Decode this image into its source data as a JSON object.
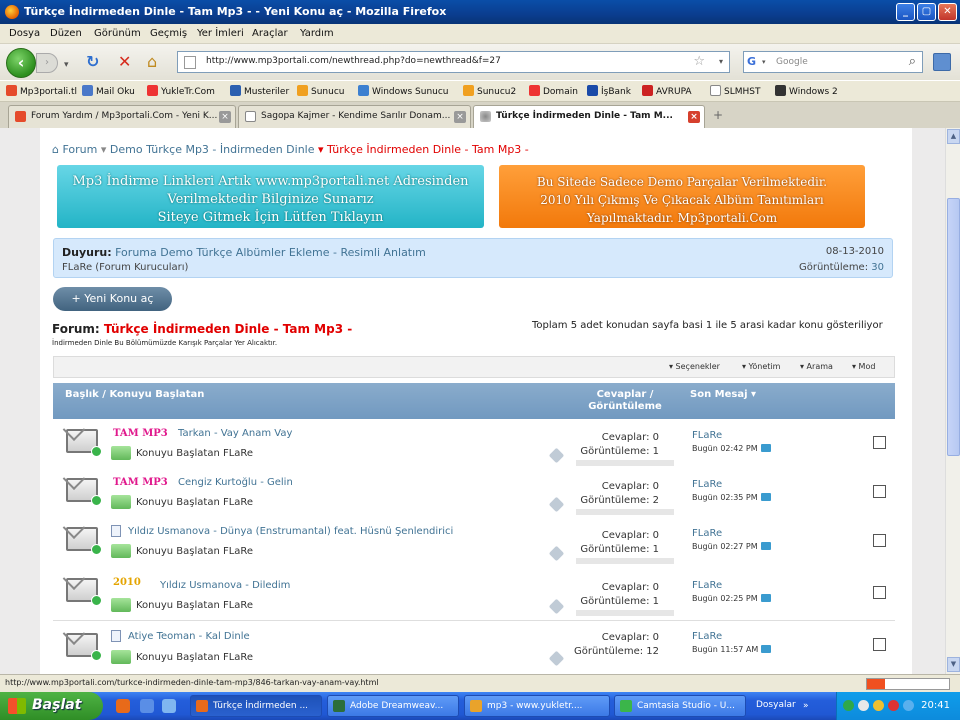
{
  "window": {
    "title": "Türkçe İndirmeden Dinle - Tam Mp3 - - Yeni Konu aç - Mozilla Firefox",
    "controls": {
      "minimize": "_",
      "maximize": "▢",
      "close": "✕"
    }
  },
  "menu": [
    "Dosya",
    "Düzen",
    "Görünüm",
    "Geçmiş",
    "Yer İmleri",
    "Araçlar",
    "Yardım"
  ],
  "nav": {
    "url": "http://www.mp3portali.com/newthread.php?do=newthread&f=27",
    "search_placeholder": "Google"
  },
  "bookmarks": [
    {
      "label": "Mp3portali.tl",
      "color": "#e54b2b"
    },
    {
      "label": "Mail Oku",
      "color": "#4a78c9"
    },
    {
      "label": "YukleTr.Com",
      "color": "#e33"
    },
    {
      "label": "Musteriler",
      "color": "#2b5fb0"
    },
    {
      "label": "Sunucu",
      "color": "#f0a020"
    },
    {
      "label": "Windows Sunucu",
      "color": "#3c80d0"
    },
    {
      "label": "Sunucu2",
      "color": "#f0a020"
    },
    {
      "label": "Domain",
      "color": "#e33"
    },
    {
      "label": "İşBank",
      "color": "#1a4aa8"
    },
    {
      "label": "AVRUPA",
      "color": "#cc2222"
    },
    {
      "label": "SLMHST",
      "color": "#ddd"
    },
    {
      "label": "Windows 2",
      "color": "#333"
    }
  ],
  "tabs": [
    {
      "label": "Forum Yardım / Mp3portali.Com - Yeni K...",
      "active": false
    },
    {
      "label": "Sagopa Kajmer - Kendime Sarılır Donam...",
      "active": false
    },
    {
      "label": "Türkçe İndirmeden Dinle - Tam M...",
      "active": true
    }
  ],
  "breadcrumb": {
    "home": "Forum",
    "parent": "Demo Türkçe Mp3 - İndirmeden Dinle",
    "current": "Türkçe İndirmeden Dinle - Tam Mp3 -"
  },
  "banners": {
    "left": [
      "Mp3 İndirme Linkleri Artık www.mp3portali.net Adresinden",
      "Verilmektedir Bilginize Sunarız",
      "Siteye Gitmek İçin Lütfen Tıklayın"
    ],
    "right": [
      "Bu Sitede Sadece Demo Parçalar Verilmektedir.",
      "2010 Yılı Çıkmış Ve Çıkacak Albüm Tanıtımları",
      "Yapılmaktadır. Mp3portali.Com"
    ]
  },
  "notice": {
    "label": "Duyuru:",
    "title": "Foruma Demo Türkçe Albümler Ekleme - Resimli Anlatım",
    "author": "FLaRe (Forum Kurucuları)",
    "date": "08-13-2010",
    "views_label": "Görüntüleme:",
    "views": "30"
  },
  "new_thread_button": "+ Yeni Konu aç",
  "forum": {
    "label": "Forum:",
    "name": "Türkçe İndirmeden Dinle - Tam Mp3 -",
    "description": "İndirmeden Dinle Bu Bölümümüzde Karışık Parçalar Yer Alıcaktır.",
    "page_info": "Toplam 5 adet konudan sayfa basi 1 ile 5 arasi kadar konu gösteriliyor"
  },
  "tools": [
    "▾ Seçenekler",
    "▾ Yönetim",
    "▾ Arama",
    "▾ Mod"
  ],
  "table_headers": {
    "title": "Başlık / Konuyu Başlatan",
    "replies_views": "Cevaplar / Görüntüleme",
    "last_post": "Son Mesaj ▾"
  },
  "threads": [
    {
      "prefix": "TAM MP3",
      "title": "Tarkan - Vay Anam Vay",
      "starter": "Konuyu Başlatan FLaRe",
      "replies": "Cevaplar: 0",
      "views": "Görüntüleme: 1",
      "last_user": "FLaRe",
      "last_time": "Bugün 02:42 PM"
    },
    {
      "prefix": "TAM MP3",
      "title": "Cengiz Kurtoğlu - Gelin",
      "starter": "Konuyu Başlatan FLaRe",
      "replies": "Cevaplar: 0",
      "views": "Görüntüleme: 2",
      "last_user": "FLaRe",
      "last_time": "Bugün 02:35 PM"
    },
    {
      "prefix": "",
      "title": "Yıldız Usmanova - Dünya (Enstrumantal) feat. Hüsnü Şenlendirici",
      "starter": "Konuyu Başlatan FLaRe",
      "replies": "Cevaplar: 0",
      "views": "Görüntüleme: 1",
      "last_user": "FLaRe",
      "last_time": "Bugün 02:27 PM"
    },
    {
      "prefix": "2010",
      "title": "Yıldız Usmanova - Diledim",
      "starter": "Konuyu Başlatan FLaRe",
      "replies": "Cevaplar: 0",
      "views": "Görüntüleme: 1",
      "last_user": "FLaRe",
      "last_time": "Bugün 02:25 PM"
    },
    {
      "prefix": "",
      "title": "Atiye Teoman - Kal Dinle",
      "starter": "Konuyu Başlatan FLaRe",
      "replies": "Cevaplar: 0",
      "views": "Görüntüleme: 12",
      "last_user": "FLaRe",
      "last_time": "Bugün 11:57 AM"
    }
  ],
  "status_url": "http://www.mp3portali.com/turkce-indirmeden-dinle-tam-mp3/846-tarkan-vay-anam-vay.html",
  "taskbar": {
    "start": "Başlat",
    "tasks": [
      {
        "label": "Türkçe İndirmeden ...",
        "active": true
      },
      {
        "label": "Adobe Dreamweav...",
        "active": false
      },
      {
        "label": "mp3 - www.yukletr....",
        "active": false
      },
      {
        "label": "Camtasia Studio - U...",
        "active": false
      }
    ],
    "folders_label": "Dosyalar",
    "clock": "20:41"
  }
}
